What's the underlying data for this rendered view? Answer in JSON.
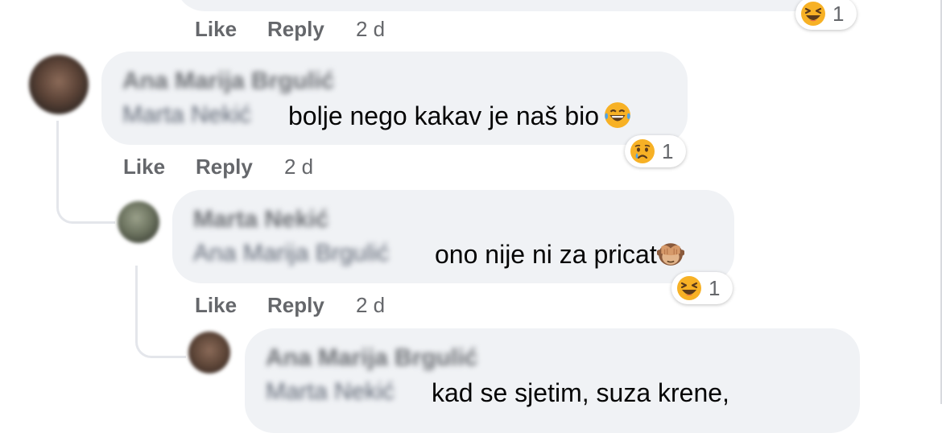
{
  "actions": {
    "like": "Like",
    "reply": "Reply"
  },
  "top_comment": {
    "time": "2 d",
    "reaction_count": "1",
    "reaction": "laughing-squint"
  },
  "comments": [
    {
      "author": "Ana Marija Brgulić",
      "mention": "Marta Nekić",
      "text": "bolje nego kakav je naš bio",
      "inline_emoji": "tears-of-joy",
      "reaction": "sad-tear",
      "reaction_count": "1",
      "time": "2 d"
    },
    {
      "author": "Marta Nekić",
      "mention": "Ana Marija Brgulić",
      "text": "ono nije ni za pricat",
      "inline_emoji": "see-no-evil-monkey",
      "reaction": "laughing-squint",
      "reaction_count": "1",
      "time": "2 d"
    },
    {
      "author": "Ana Marija Brgulić",
      "mention": "Marta Nekić",
      "text": "kad se sjetim, suza krene,"
    }
  ]
}
